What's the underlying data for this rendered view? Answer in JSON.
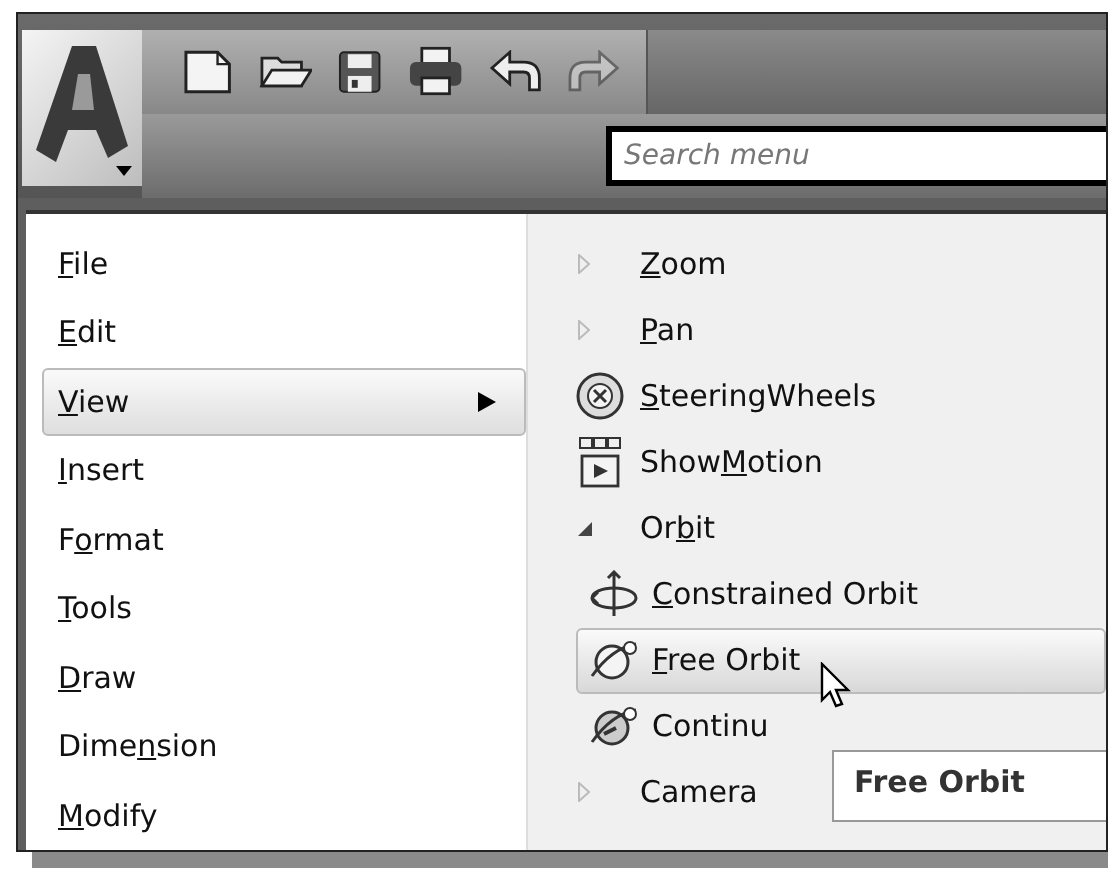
{
  "quick_access": [
    {
      "kind": "new",
      "disabled": false
    },
    {
      "kind": "open",
      "disabled": false
    },
    {
      "kind": "save",
      "disabled": false
    },
    {
      "kind": "print",
      "disabled": false
    },
    {
      "kind": "undo",
      "disabled": false
    },
    {
      "kind": "redo",
      "disabled": true
    }
  ],
  "search": {
    "placeholder": "Search menu"
  },
  "menu": [
    {
      "label_parts": [
        {
          "text": "F",
          "underlined": true
        },
        {
          "text": "ile",
          "underlined": false
        }
      ],
      "selected": false,
      "has_submenu": false
    },
    {
      "label_parts": [
        {
          "text": "E",
          "underlined": true
        },
        {
          "text": "dit",
          "underlined": false
        }
      ],
      "selected": false,
      "has_submenu": false
    },
    {
      "label_parts": [
        {
          "text": "V",
          "underlined": true
        },
        {
          "text": "iew",
          "underlined": false
        }
      ],
      "selected": true,
      "has_submenu": true
    },
    {
      "label_parts": [
        {
          "text": "I",
          "underlined": true
        },
        {
          "text": "nsert",
          "underlined": false
        }
      ],
      "selected": false,
      "has_submenu": false
    },
    {
      "label_parts": [
        {
          "text": "F",
          "underlined": false
        },
        {
          "text": "o",
          "underlined": true
        },
        {
          "text": "rmat",
          "underlined": false
        }
      ],
      "selected": false,
      "has_submenu": false
    },
    {
      "label_parts": [
        {
          "text": "T",
          "underlined": true
        },
        {
          "text": "ools",
          "underlined": false
        }
      ],
      "selected": false,
      "has_submenu": false
    },
    {
      "label_parts": [
        {
          "text": "D",
          "underlined": true
        },
        {
          "text": "raw",
          "underlined": false
        }
      ],
      "selected": false,
      "has_submenu": false
    },
    {
      "label_parts": [
        {
          "text": "Dime",
          "underlined": false
        },
        {
          "text": "n",
          "underlined": true
        },
        {
          "text": "sion",
          "underlined": false
        }
      ],
      "selected": false,
      "has_submenu": false
    },
    {
      "label_parts": [
        {
          "text": "M",
          "underlined": true
        },
        {
          "text": "odify",
          "underlined": false
        }
      ],
      "selected": false,
      "has_submenu": false
    }
  ],
  "submenu": [
    {
      "label_parts": [
        {
          "text": "Z",
          "underlined": true
        },
        {
          "text": "oom",
          "underlined": false
        }
      ],
      "kind": "collapsed"
    },
    {
      "label_parts": [
        {
          "text": "P",
          "underlined": true
        },
        {
          "text": "an",
          "underlined": false
        }
      ],
      "kind": "collapsed"
    },
    {
      "label_parts": [
        {
          "text": "S",
          "underlined": true
        },
        {
          "text": "teeringWheels",
          "underlined": false
        }
      ],
      "kind": "steering"
    },
    {
      "label_parts": [
        {
          "text": "Show",
          "underlined": false
        },
        {
          "text": "M",
          "underlined": true
        },
        {
          "text": "otion",
          "underlined": false
        }
      ],
      "kind": "showmotion"
    },
    {
      "label_parts": [
        {
          "text": "Or",
          "underlined": false
        },
        {
          "text": "b",
          "underlined": true
        },
        {
          "text": "it",
          "underlined": false
        }
      ],
      "kind": "expanded",
      "children": [
        {
          "label_parts": [
            {
              "text": "C",
              "underlined": true
            },
            {
              "text": "onstrained Orbit",
              "underlined": false
            }
          ],
          "kind": "constrained",
          "selected": false
        },
        {
          "label_parts": [
            {
              "text": "F",
              "underlined": true
            },
            {
              "text": "ree Orbit",
              "underlined": false
            }
          ],
          "kind": "free",
          "selected": true
        },
        {
          "label_parts": [
            {
              "text": "Continu",
              "underlined": false
            }
          ],
          "kind": "continuous",
          "selected": false
        }
      ]
    },
    {
      "label_parts": [
        {
          "text": "Camera",
          "underlined": false
        }
      ],
      "kind": "collapsed"
    }
  ],
  "tooltip": {
    "text": "Free Orbit"
  }
}
